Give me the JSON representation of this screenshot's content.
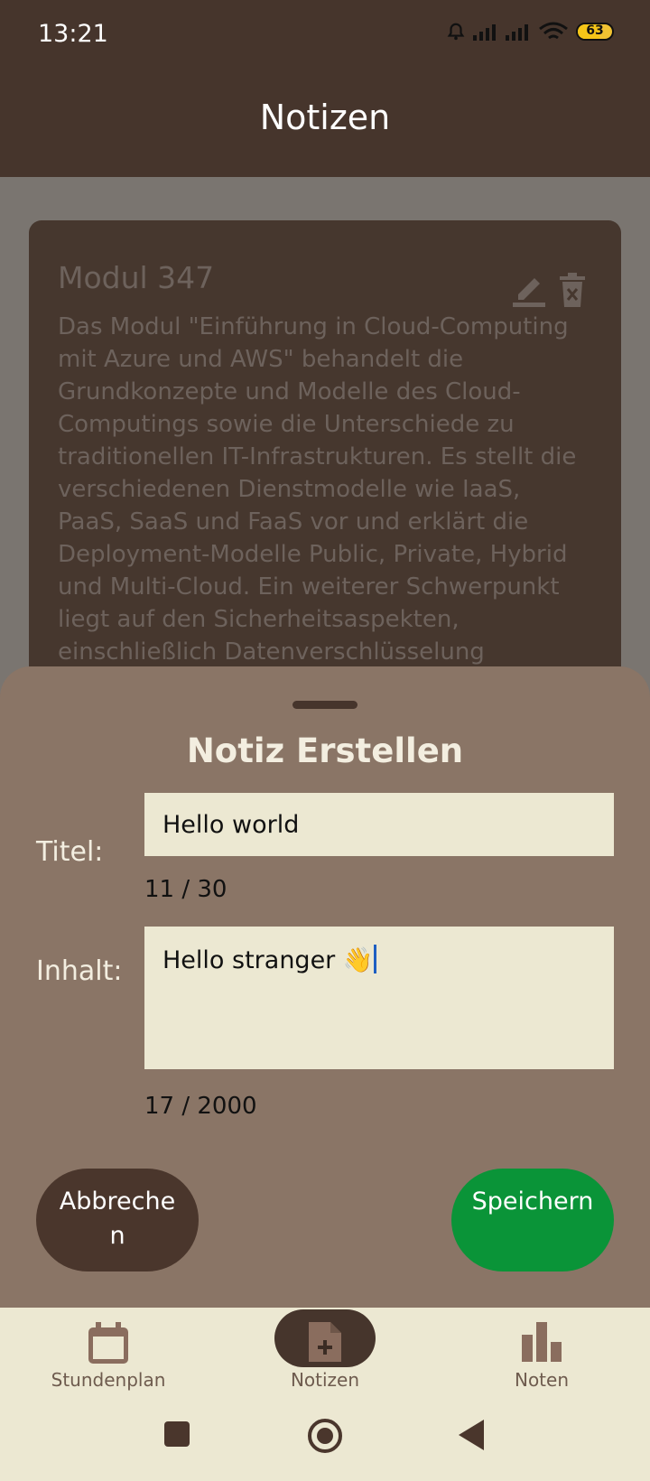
{
  "status": {
    "time": "13:21",
    "battery": "63"
  },
  "appbar": {
    "title": "Notizen"
  },
  "note": {
    "title": "Modul 347",
    "body": "Das Modul \"Einführung in Cloud-Computing mit Azure und AWS\" behandelt die Grundkonzepte und Modelle des Cloud-Computings sowie die Unterschiede zu traditionellen IT-Infrastrukturen. Es stellt die verschiedenen Dienstmodelle wie IaaS, PaaS, SaaS und FaaS vor und erklärt die Deployment-Modelle Public, Private, Hybrid und Multi-Cloud. Ein weiterer Schwerpunkt liegt auf den Sicherheitsaspekten, einschließlich Datenverschlüsselung"
  },
  "sheet": {
    "title": "Notiz Erstellen",
    "title_label": "Titel:",
    "title_value": "Hello world",
    "title_counter": "11 / 30",
    "content_label": "Inhalt:",
    "content_value": "Hello stranger 👋",
    "content_counter": "17 / 2000",
    "cancel_label": "Abbreche\nn",
    "save_label": "Speichern"
  },
  "nav": {
    "items": [
      {
        "label": "Stundenplan",
        "icon": "calendar-icon"
      },
      {
        "label": "Notizen",
        "icon": "note-add-icon",
        "active": true
      },
      {
        "label": "Noten",
        "icon": "bar-chart-icon"
      }
    ]
  },
  "colors": {
    "header": "#46352c",
    "sheet": "#8a7566",
    "save": "#0a9438",
    "cancel": "#4a362c",
    "field": "#ece8d2"
  }
}
